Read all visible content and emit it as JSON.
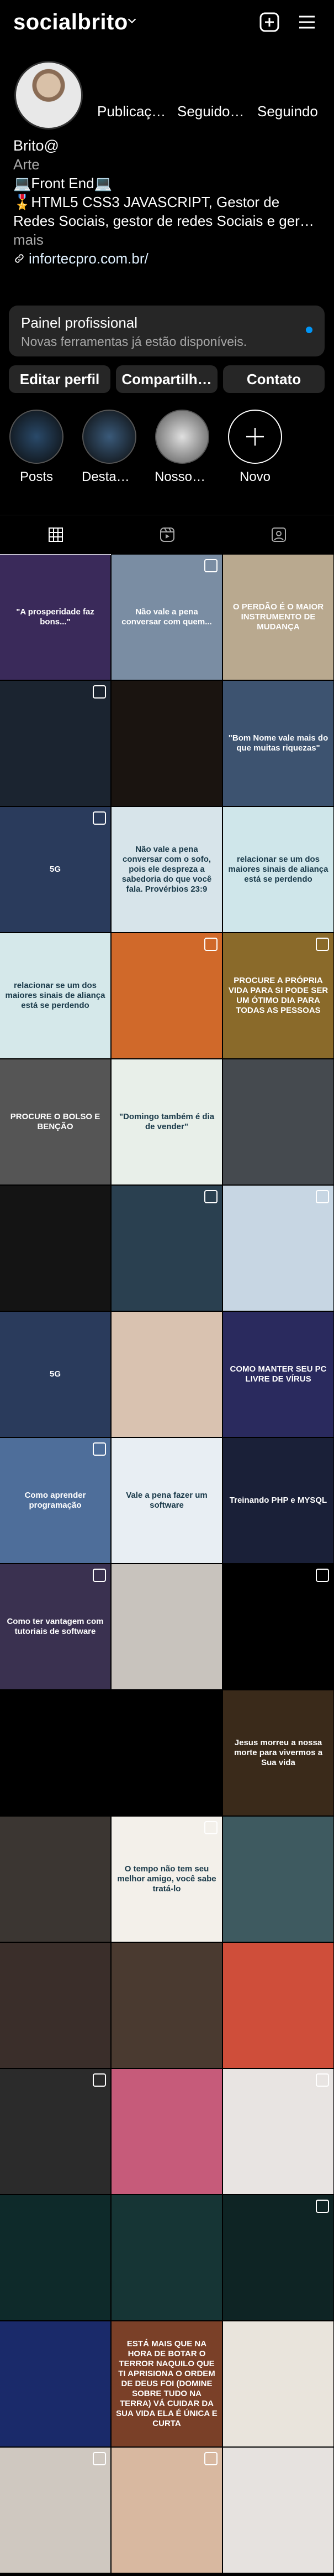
{
  "header": {
    "username": "socialbrito"
  },
  "profile": {
    "stats": [
      "Publicaç…",
      "Seguidor…",
      "Seguindo"
    ],
    "name": "Brito@",
    "category": "Arte",
    "bio_lines": [
      "💻Front End💻",
      "🎖️HTML5 CSS3 JAVASCRIPT, Gestor de",
      "Redes Sociais, gestor de redes Sociais e ger…"
    ],
    "more": "mais",
    "link": "infortecpro.com.br/"
  },
  "panel": {
    "title": "Painel profissional",
    "subtitle": "Novas ferramentas já estão disponíveis."
  },
  "buttons": {
    "edit": "Editar perfil",
    "share": "Compartilh…",
    "contact": "Contato"
  },
  "highlights": [
    {
      "label": "Posts"
    },
    {
      "label": "Destaques"
    },
    {
      "label": "Nossos pr…"
    },
    {
      "label": "Novo"
    }
  ],
  "posts": [
    {
      "text": "\"A prosperidade faz bons...\"",
      "bg": "#3a2a5a"
    },
    {
      "text": "Não vale a pena conversar com quem...",
      "bg": "#7a8da3"
    },
    {
      "text": "O PERDÃO É O MAIOR INSTRUMENTO DE MUDANÇA",
      "bg": "#b9a98f"
    },
    {
      "text": "",
      "bg": "#1b2430"
    },
    {
      "text": "",
      "bg": "#1a1410"
    },
    {
      "text": "\"Bom Nome vale mais do que muitas riquezas\"",
      "bg": "#3d5370"
    },
    {
      "text": "5G",
      "bg": "#2a3b5c"
    },
    {
      "text": "Não vale a pena conversar com o sofo, pois ele despreza a sabedoria do que você fala. Provérbios 23:9",
      "bg": "#d7e4ea"
    },
    {
      "text": "relacionar se um dos maiores sinais de aliança está se perdendo",
      "bg": "#cfe6ea"
    },
    {
      "text": "relacionar se um dos maiores sinais de aliança está se perdendo",
      "bg": "#d5e8ea"
    },
    {
      "text": "",
      "bg": "#d0692a"
    },
    {
      "text": "PROCURE A PRÓPRIA VIDA PARA SI PODE SER UM ÓTIMO DIA PARA TODAS AS PESSOAS",
      "bg": "#8a6a2a"
    },
    {
      "text": "PROCURE O BOLSO E BENÇÃO",
      "bg": "#555"
    },
    {
      "text": "\"Domingo também é dia de vender\"",
      "bg": "#e8efe9"
    },
    {
      "text": "",
      "bg": "#454a4f"
    },
    {
      "text": "",
      "bg": "#141414"
    },
    {
      "text": "",
      "bg": "#2a4050"
    },
    {
      "text": "",
      "bg": "#c7d6e3"
    },
    {
      "text": "5G",
      "bg": "#2a3b5c"
    },
    {
      "text": "",
      "bg": "#d9c2b0"
    },
    {
      "text": "COMO MANTER SEU PC LIVRE DE VÍRUS",
      "bg": "#2a2a5e"
    },
    {
      "text": "Como aprender programação",
      "bg": "#4e6e9a"
    },
    {
      "text": "Vale a pena fazer um software",
      "bg": "#e8eef3"
    },
    {
      "text": "Treinando PHP e MYSQL",
      "bg": "#1a2038"
    },
    {
      "text": "Como ter vantagem com tutoriais de software",
      "bg": "#3a3150"
    },
    {
      "text": "",
      "bg": "#c8c3bd"
    },
    {
      "text": "",
      "bg": "#000000"
    },
    {
      "text": "",
      "bg": "#000000"
    },
    {
      "text": "",
      "bg": "#000000"
    },
    {
      "text": "Jesus morreu a nossa morte para vivermos a Sua vida",
      "bg": "#3a2a1a"
    },
    {
      "text": "",
      "bg": "#3b3632"
    },
    {
      "text": "O tempo não tem seu melhor amigo, você sabe tratá-lo",
      "bg": "#f3f0ea"
    },
    {
      "text": "",
      "bg": "#3e5a60"
    },
    {
      "text": "",
      "bg": "#3a2e2a"
    },
    {
      "text": "",
      "bg": "#4a3a30"
    },
    {
      "text": "",
      "bg": "#cf4e3a"
    },
    {
      "text": "",
      "bg": "#2b2b2b"
    },
    {
      "text": "",
      "bg": "#c65b7a"
    },
    {
      "text": "",
      "bg": "#e8e4e2"
    },
    {
      "text": "",
      "bg": "#0e2a2a"
    },
    {
      "text": "",
      "bg": "#163535"
    },
    {
      "text": "",
      "bg": "#0e2424"
    },
    {
      "text": "",
      "bg": "#1a2a6a"
    },
    {
      "text": "ESTÁ MAIS QUE NA HORA DE BOTAR O TERROR NAQUILO QUE TI APRISIONA O ORDEM DE DEUS FOI (DOMINE SOBRE TUDO NA TERRA) VÁ CUIDAR DA SUA VIDA ELA É ÚNICA E CURTA",
      "bg": "#7a4028"
    },
    {
      "text": "",
      "bg": "#e9e4dc"
    },
    {
      "text": "",
      "bg": "#cfc8c0"
    },
    {
      "text": "",
      "bg": "#d8b8a0"
    },
    {
      "text": "",
      "bg": "#e6e2df"
    }
  ],
  "colors": {
    "accent": "#0095f6",
    "bg": "#000000",
    "panel": "#262626",
    "muted": "#a8a8a8"
  }
}
